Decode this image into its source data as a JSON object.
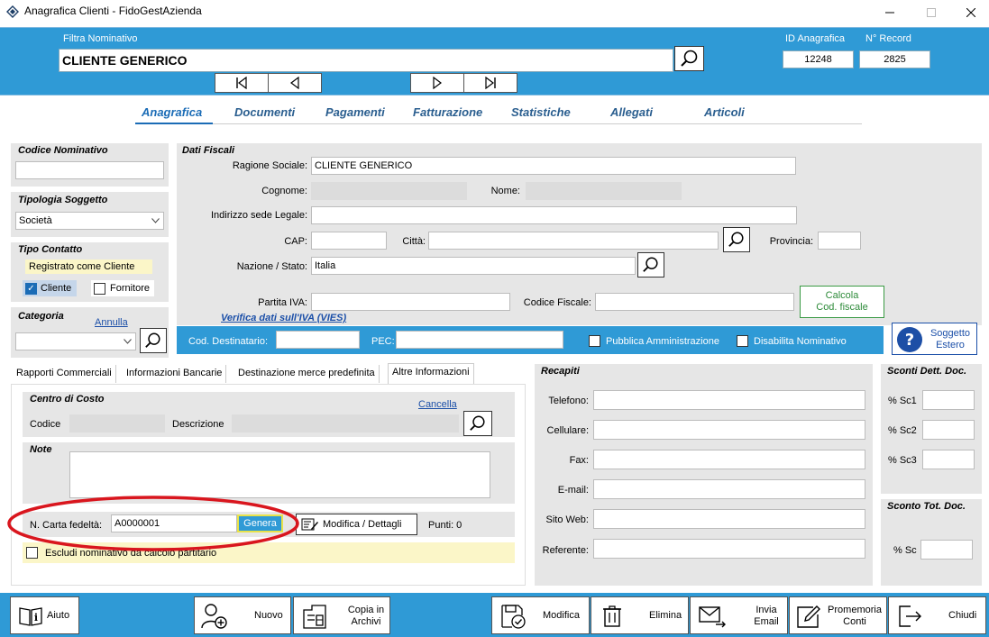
{
  "window": {
    "title": "Anagrafica Clienti - FidoGestAzienda"
  },
  "header": {
    "filter_label": "Filtra Nominativo",
    "filter_value": "CLIENTE GENERICO",
    "id_label": "ID Anagrafica",
    "id_value": "12248",
    "record_label": "N° Record",
    "record_value": "2825"
  },
  "tabs": [
    "Anagrafica",
    "Documenti",
    "Pagamenti",
    "Fatturazione",
    "Statistiche",
    "Allegati",
    "Articoli"
  ],
  "left": {
    "codice_title": "Codice Nominativo",
    "codice_value": "",
    "tipologia_title": "Tipologia Soggetto",
    "tipologia_value": "Società",
    "contatto_title": "Tipo Contatto",
    "contatto_status": "Registrato come Cliente",
    "cliente_label": "Cliente",
    "fornitore_label": "Fornitore",
    "categoria_title": "Categoria",
    "categoria_annulla": "Annulla",
    "categoria_value": ""
  },
  "fiscali": {
    "title": "Dati Fiscali",
    "ragione_label": "Ragione Sociale:",
    "ragione_value": "CLIENTE GENERICO",
    "cognome_label": "Cognome:",
    "nome_label": "Nome:",
    "indirizzo_label": "Indirizzo sede Legale:",
    "cap_label": "CAP:",
    "citta_label": "Città:",
    "provincia_label": "Provincia:",
    "nazione_label": "Nazione / Stato:",
    "nazione_value": "Italia",
    "piva_label": "Partita IVA:",
    "cf_label": "Codice Fiscale:",
    "calcola_line1": "Calcola",
    "calcola_line2": "Cod. fiscale",
    "vies_link": "Verifica dati sull'IVA (VIES)",
    "coddest_label": "Cod. Destinatario:",
    "pec_label": "PEC:",
    "pa_label": "Pubblica Amministrazione",
    "disabilita_label": "Disabilita Nominativo",
    "soggetto_line1": "Soggetto",
    "soggetto_line2": "Estero"
  },
  "subtabs": [
    "Rapporti Commerciali",
    "Informazioni Bancarie",
    "Destinazione merce predefinita",
    "Altre Informazioni"
  ],
  "altre": {
    "centro_title": "Centro di Costo",
    "cancella_link": "Cancella",
    "codice_label": "Codice",
    "descrizione_label": "Descrizione",
    "note_title": "Note",
    "carta_label": "N. Carta fedeltà:",
    "carta_value": "A0000001",
    "genera_label": "Genera",
    "modifica_label": "Modifica / Dettagli",
    "punti_label": "Punti: 0",
    "escludi_label": "Escludi nominativo da calcolo partitario"
  },
  "recapiti": {
    "title": "Recapiti",
    "labels": [
      "Telefono:",
      "Cellulare:",
      "Fax:",
      "E-mail:",
      "Sito Web:",
      "Referente:"
    ]
  },
  "sconti": {
    "dett_title": "Sconti Dett. Doc.",
    "dett_labels": [
      "% Sc1",
      "% Sc2",
      "% Sc3"
    ],
    "tot_title": "Sconto Tot. Doc.",
    "tot_label": "% Sc"
  },
  "bottom": {
    "aiuto": "Aiuto",
    "nuovo": "Nuovo",
    "copia_l1": "Copia in",
    "copia_l2": "Archivi",
    "modifica": "Modifica",
    "elimina": "Elimina",
    "invia_l1": "Invia",
    "invia_l2": "Email",
    "promemoria_l1": "Promemoria",
    "promemoria_l2": "Conti",
    "chiudi": "Chiudi"
  },
  "colors": {
    "header": "#2f9ad6",
    "accent": "#1b6cb6",
    "annotation": "#d9161e",
    "green": "#2e8b3a"
  }
}
